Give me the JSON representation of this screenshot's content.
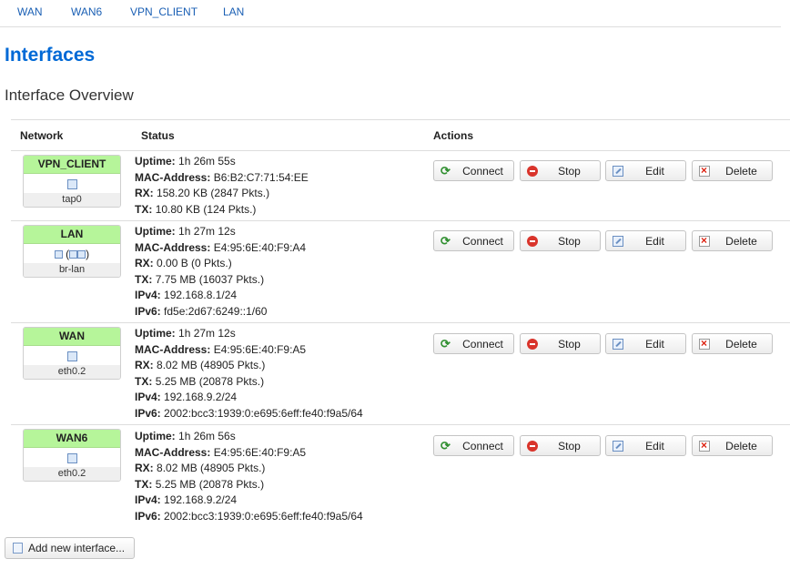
{
  "tabs": [
    "WAN",
    "WAN6",
    "VPN_CLIENT",
    "LAN"
  ],
  "page_title": "Interfaces",
  "section_title": "Interface Overview",
  "columns": {
    "network": "Network",
    "status": "Status",
    "actions": "Actions"
  },
  "actions": {
    "connect": "Connect",
    "stop": "Stop",
    "edit": "Edit",
    "delete": "Delete"
  },
  "labels": {
    "uptime": "Uptime:",
    "mac": "MAC-Address:",
    "rx": "RX:",
    "tx": "TX:",
    "ipv4": "IPv4:",
    "ipv6": "IPv6:"
  },
  "interfaces": [
    {
      "name": "VPN_CLIENT",
      "device": "tap0",
      "uptime": "1h 26m 55s",
      "mac": "B6:B2:C7:71:54:EE",
      "rx": "158.20 KB (2847 Pkts.)",
      "tx": "10.80 KB (124 Pkts.)",
      "ipv4": "",
      "ipv6": ""
    },
    {
      "name": "LAN",
      "device": "br-lan",
      "uptime": "1h 27m 12s",
      "mac": "E4:95:6E:40:F9:A4",
      "rx": "0.00 B (0 Pkts.)",
      "tx": "7.75 MB (16037 Pkts.)",
      "ipv4": "192.168.8.1/24",
      "ipv6": "fd5e:2d67:6249::1/60"
    },
    {
      "name": "WAN",
      "device": "eth0.2",
      "uptime": "1h 27m 12s",
      "mac": "E4:95:6E:40:F9:A5",
      "rx": "8.02 MB (48905 Pkts.)",
      "tx": "5.25 MB (20878 Pkts.)",
      "ipv4": "192.168.9.2/24",
      "ipv6": "2002:bcc3:1939:0:e695:6eff:fe40:f9a5/64"
    },
    {
      "name": "WAN6",
      "device": "eth0.2",
      "uptime": "1h 26m 56s",
      "mac": "E4:95:6E:40:F9:A5",
      "rx": "8.02 MB (48905 Pkts.)",
      "tx": "5.25 MB (20878 Pkts.)",
      "ipv4": "192.168.9.2/24",
      "ipv6": "2002:bcc3:1939:0:e695:6eff:fe40:f9a5/64"
    }
  ],
  "add_button": "Add new interface...",
  "colors": {
    "accent": "#0069d6",
    "link": "#1a5fb4",
    "network_badge": "#b6f59a"
  }
}
